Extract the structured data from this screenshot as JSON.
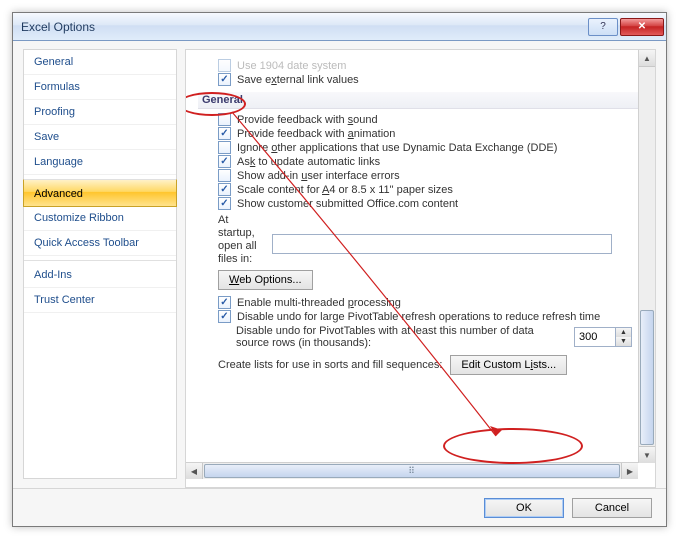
{
  "title": "Excel Options",
  "sidebar": {
    "items": [
      {
        "label": "General"
      },
      {
        "label": "Formulas"
      },
      {
        "label": "Proofing"
      },
      {
        "label": "Save"
      },
      {
        "label": "Language"
      },
      {
        "label": "Advanced"
      },
      {
        "label": "Customize Ribbon"
      },
      {
        "label": "Quick Access Toolbar"
      },
      {
        "label": "Add-Ins"
      },
      {
        "label": "Trust Center"
      }
    ],
    "selected_index": 5,
    "separator_after": [
      4,
      7
    ]
  },
  "section_header": "General",
  "top_options": [
    {
      "checked": false,
      "label_html": "Use 1904 date system"
    },
    {
      "checked": true,
      "label_html": "Save e<span class='u'>x</span>ternal link values"
    }
  ],
  "general_options": [
    {
      "checked": false,
      "label_html": "Provide feedback with <span class='u'>s</span>ound"
    },
    {
      "checked": true,
      "label_html": "Provide feedback with <span class='u'>a</span>nimation"
    },
    {
      "checked": false,
      "label_html": "Ignore <span class='u'>o</span>ther applications that use Dynamic Data Exchange (DDE)"
    },
    {
      "checked": true,
      "label_html": "As<span class='u'>k</span> to update automatic links"
    },
    {
      "checked": false,
      "label_html": "Show add-in <span class='u'>u</span>ser interface errors"
    },
    {
      "checked": true,
      "label_html": "Sca<span class='u'>l</span>e content for A4 or 8.5 x 11\" paper sizes"
    },
    {
      "checked": true,
      "label_html": "Show customer submitted Office.com content"
    }
  ],
  "startup": {
    "label": "At startup, open all files in:",
    "value": ""
  },
  "web_options_btn": "Web Options...",
  "threading": [
    {
      "checked": true,
      "label_html": "Enable multi-threaded <span class='u'>p</span>rocessing"
    },
    {
      "checked": true,
      "label_html": "Disable undo for large PivotTable refresh operations to reduce refresh time"
    }
  ],
  "undo_rows": {
    "label": "Disable undo for PivotTables with at least this number of data source rows (in thousands):",
    "value": "300"
  },
  "create_lists_label": "Create lists for use in sorts and fill sequences:",
  "edit_custom_lists_btn": "Edit Custom Lists...",
  "footer": {
    "ok": "OK",
    "cancel": "Cancel"
  }
}
